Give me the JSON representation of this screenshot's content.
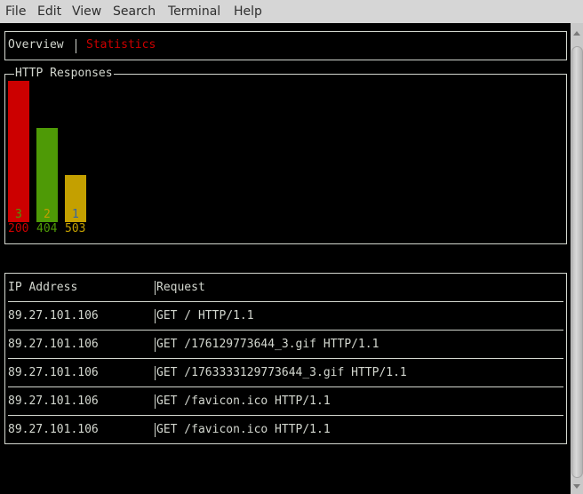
{
  "menubar": {
    "items": [
      "File",
      "Edit",
      "View",
      "Search",
      "Terminal",
      "Help"
    ]
  },
  "tabs": {
    "items": [
      {
        "label": "Overview",
        "active": false
      },
      {
        "label": "Statistics",
        "active": true
      }
    ],
    "separator": "|"
  },
  "chart_data": {
    "type": "bar",
    "title": "HTTP Responses",
    "categories": [
      "200",
      "404",
      "503"
    ],
    "values": [
      3,
      2,
      1
    ],
    "colors": [
      "#cc0000",
      "#4e9a06",
      "#c4a000"
    ],
    "value_label_colors": [
      "#4e9a06",
      "#c4a000",
      "#3465a4"
    ],
    "ylim": [
      0,
      3
    ],
    "xlabel": "",
    "ylabel": ""
  },
  "table": {
    "columns": [
      "IP Address",
      "Request"
    ],
    "rows": [
      [
        "89.27.101.106",
        "GET / HTTP/1.1"
      ],
      [
        "89.27.101.106",
        "GET /176129773644_3.gif HTTP/1.1"
      ],
      [
        "89.27.101.106",
        "GET /1763333129773644_3.gif HTTP/1.1"
      ],
      [
        "89.27.101.106",
        "GET /favicon.ico HTTP/1.1"
      ],
      [
        "89.27.101.106",
        "GET /favicon.ico HTTP/1.1"
      ]
    ]
  },
  "colors": {
    "foreground": "#d3d7cf",
    "active_tab": "#cc0000",
    "background": "#000000"
  }
}
